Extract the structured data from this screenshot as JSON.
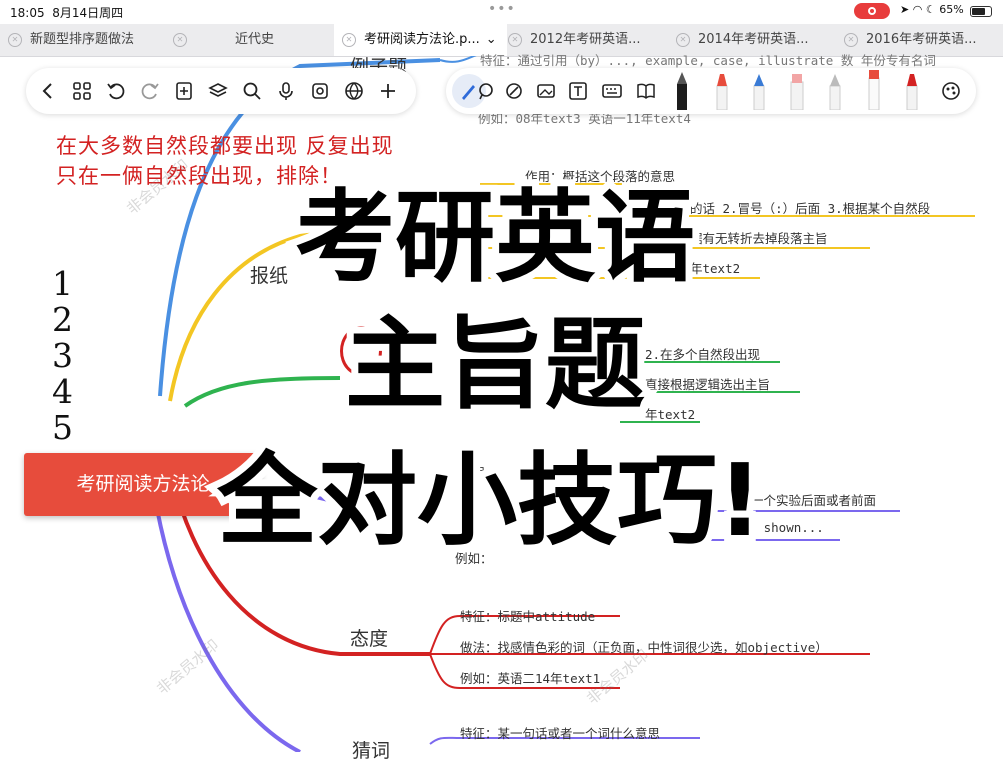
{
  "status_bar": {
    "time": "18:05",
    "date": "8月14日周四",
    "battery": "65%",
    "record_color": "#e83c3c"
  },
  "tabs": [
    {
      "label": "新题型排序题做法",
      "active": false
    },
    {
      "label": "近代史",
      "active": false
    },
    {
      "label": "考研阅读方法论.p...",
      "active": true
    },
    {
      "label": "2012年考研英语...",
      "active": false
    },
    {
      "label": "2014年考研英语...",
      "active": false
    },
    {
      "label": "2016年考研英语...",
      "active": false
    }
  ],
  "toolbar": {
    "left_icons": [
      "back-icon",
      "grid-icon",
      "undo-icon",
      "redo-icon",
      "add-page-icon",
      "layers-icon",
      "search-icon",
      "microphone-icon",
      "sticker-icon",
      "globe-icon",
      "plus-icon"
    ],
    "right_icons": [
      "pen-icon",
      "lasso-icon",
      "shapes-icon",
      "image-icon",
      "text-icon",
      "keyboard-icon",
      "book-icon",
      "fountain-pen-tool",
      "marker-red-tool",
      "pen-blue-tool",
      "marker-pink-tool",
      "pencil-gray-tool",
      "pen-white-tool",
      "highlighter-red-tool",
      "color-palette-icon"
    ]
  },
  "mindmap": {
    "root": "考研阅读方法论",
    "root_color": "#e74c3c",
    "branches": {
      "example": "例子题",
      "newspaper": "报纸",
      "attitude": "态度",
      "word": "猜词"
    },
    "nodes": {
      "ex_feature": "特征：通过引用（by）..., example, case, illustrate 数 年份专有名词",
      "ex_example": "例如：08年text3 英语一11年text4",
      "np_role": "作用：概括这个段落的意思",
      "np_method": "的话 2.冒号（:）后面 3.根据某个自然段",
      "np_turn": "据有无转折去掉段落主旨",
      "np_year": "年text2",
      "mid_appear": "2.在多个自然段出现",
      "mid_logic": "直接根据逻辑选出主旨",
      "mid_year": "年text2",
      "exp_front": "在某一个实验后面或者前面",
      "exp_words": "est, shown...",
      "exp_role": "作用",
      "exp_example": "例如：",
      "att_feature": "特征：标题中attitude",
      "att_method": "做法：找感情色彩的词（正负面，中性词很少选，如objective）",
      "att_example": "例如：英语二14年text1",
      "word_feature": "特征：某一句话或者一个词什么意思"
    }
  },
  "handwriting": {
    "line1": "在大多数自然段都要出现 反复出现",
    "line2": "只在一俩自然段出现，排除！",
    "numbers": [
      "1",
      "2",
      "3",
      "4",
      "5"
    ],
    "color": "#d32222"
  },
  "watermark": "非会员水印",
  "overlay": {
    "line1": "考研英语",
    "line2": "主旨题",
    "line3": "全对小技巧!"
  }
}
